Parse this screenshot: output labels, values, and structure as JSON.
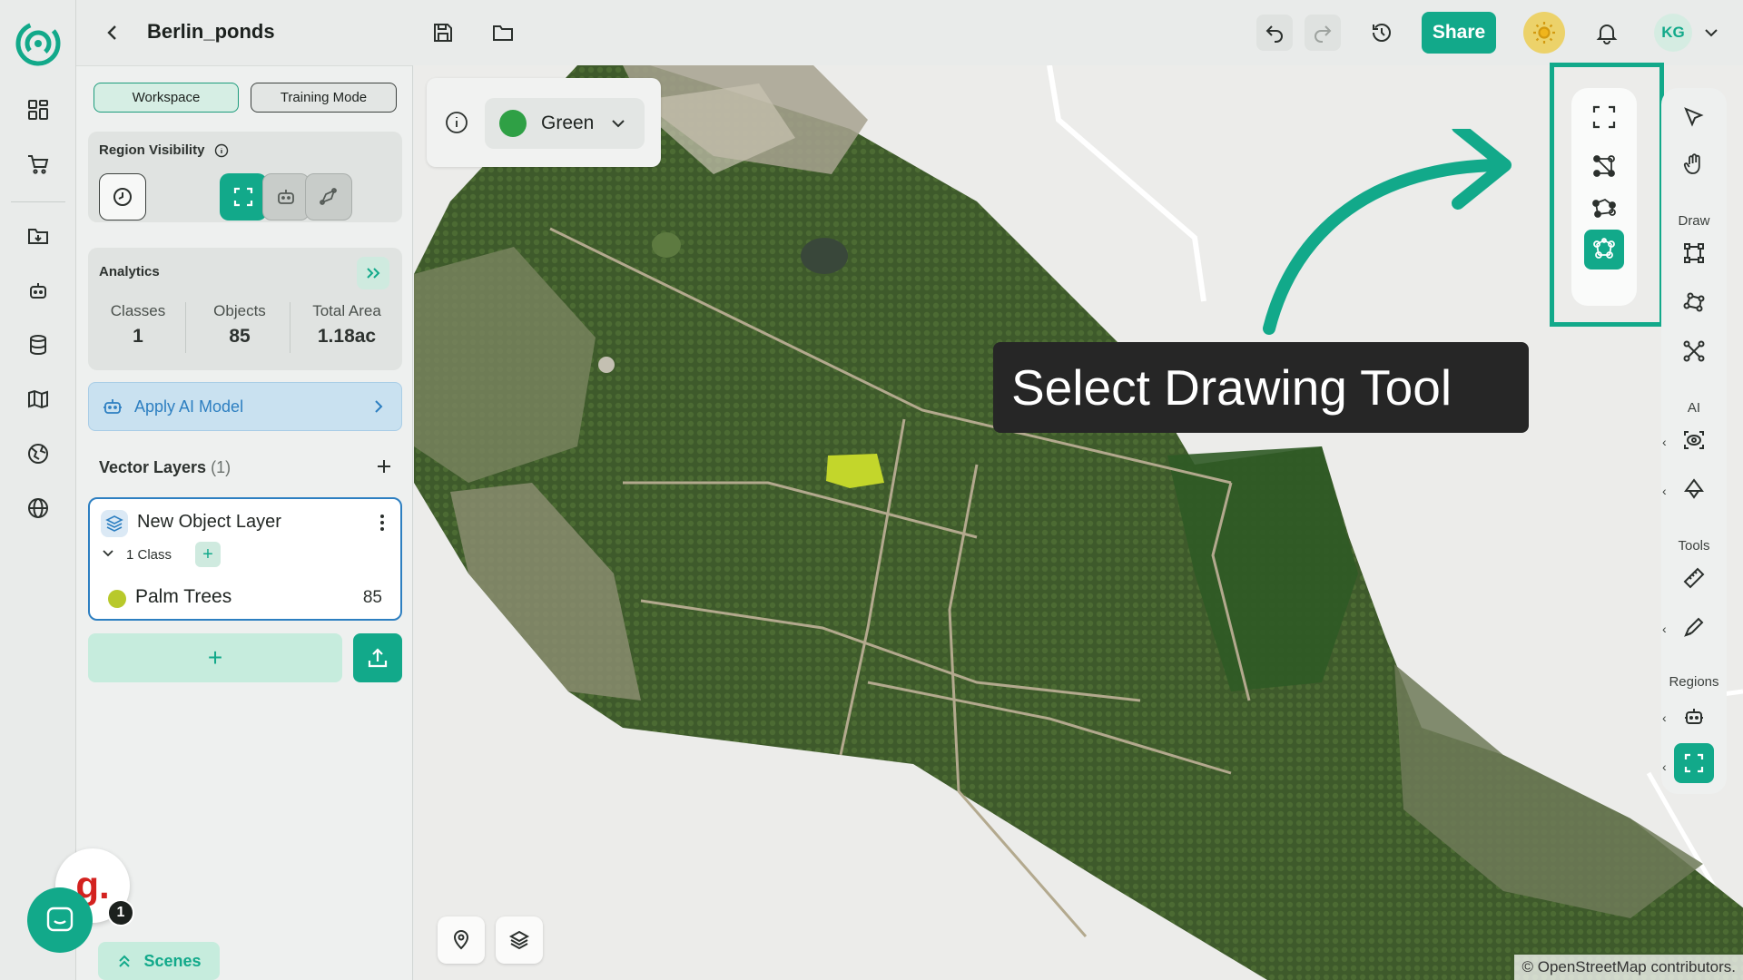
{
  "header": {
    "project_title": "Berlin_ponds",
    "share_label": "Share",
    "avatar_initials": "KG"
  },
  "panel": {
    "workspace_label": "Workspace",
    "training_mode_label": "Training Mode",
    "region_visibility_title": "Region Visibility",
    "analytics": {
      "title": "Analytics",
      "stats": [
        {
          "label": "Classes",
          "value": "1"
        },
        {
          "label": "Objects",
          "value": "85"
        },
        {
          "label": "Total Area",
          "value": "1.18ac"
        }
      ]
    },
    "apply_ai_label": "Apply AI Model",
    "vector_layers_title": "Vector Layers",
    "vector_layers_count": "(1)",
    "layer": {
      "name": "New Object Layer",
      "class_count_label": "1 Class",
      "class_name": "Palm Trees",
      "class_object_count": "85",
      "class_color": "#b8c92b"
    },
    "add_layer_symbol": "+",
    "scenes_label": "Scenes"
  },
  "chat": {
    "brand_letter": "g.",
    "badge_count": "1"
  },
  "map": {
    "band_label": "Green",
    "band_color": "#2fa045",
    "tooltip_text": "Select Drawing Tool",
    "attribution": "© OpenStreetMap contributors."
  },
  "toolbar": {
    "section_draw": "Draw",
    "section_ai": "AI",
    "section_tools": "Tools",
    "section_regions": "Regions"
  },
  "colors": {
    "accent": "#12a98a",
    "info_blue": "#2d7fc1"
  }
}
